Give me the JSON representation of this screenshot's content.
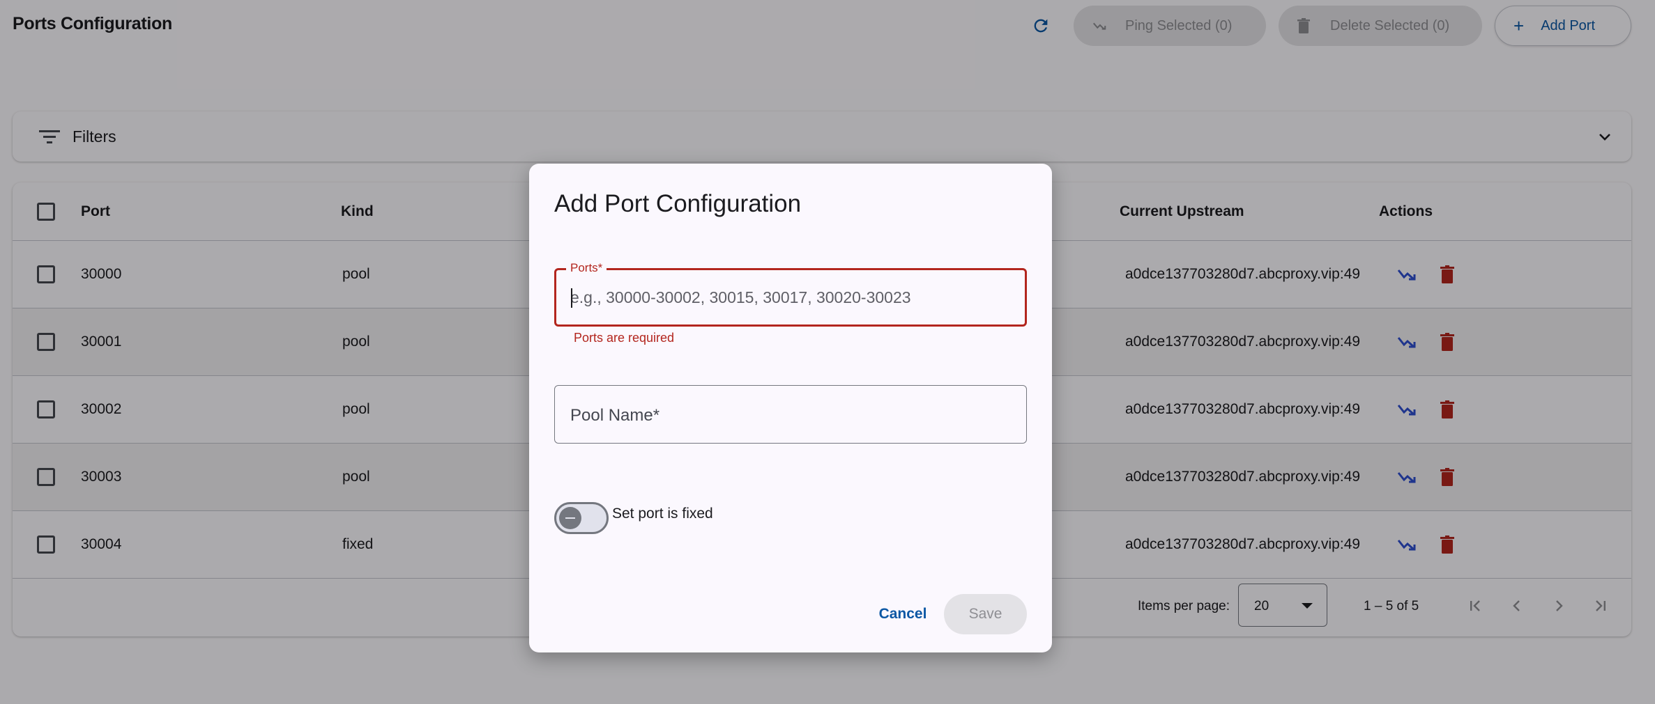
{
  "header": {
    "title": "Ports Configuration",
    "ping_selected": "Ping Selected (0)",
    "delete_selected": "Delete Selected (0)",
    "add_port": "Add Port"
  },
  "filters": {
    "label": "Filters"
  },
  "table": {
    "columns": {
      "port": "Port",
      "kind": "Kind",
      "current_upstream": "Current Upstream",
      "actions": "Actions"
    },
    "rows": [
      {
        "port": "30000",
        "kind": "pool",
        "upstream": "a0dce137703280d7.abcproxy.vip:49"
      },
      {
        "port": "30001",
        "kind": "pool",
        "upstream": "a0dce137703280d7.abcproxy.vip:49"
      },
      {
        "port": "30002",
        "kind": "pool",
        "upstream": "a0dce137703280d7.abcproxy.vip:49"
      },
      {
        "port": "30003",
        "kind": "pool",
        "upstream": "a0dce137703280d7.abcproxy.vip:49"
      },
      {
        "port": "30004",
        "kind": "fixed",
        "upstream": "a0dce137703280d7.abcproxy.vip:49"
      }
    ]
  },
  "paginator": {
    "items_per_page_label": "Items per page:",
    "page_size": "20",
    "range": "1 – 5 of 5"
  },
  "dialog": {
    "title": "Add Port Configuration",
    "ports_label": "Ports*",
    "ports_placeholder": "e.g., 30000-30002, 30015, 30017, 30020-30023",
    "ports_value": "",
    "ports_error": "Ports are required",
    "pool_name_label": "Pool Name*",
    "pool_name_value": "",
    "fixed_toggle_label": "Set port is fixed",
    "fixed_toggle_on": false,
    "cancel": "Cancel",
    "save": "Save"
  },
  "colors": {
    "primary": "#0b57a4",
    "error": "#b3261e",
    "ping_icon": "#2f4fd0",
    "delete_icon": "#b3261e"
  }
}
